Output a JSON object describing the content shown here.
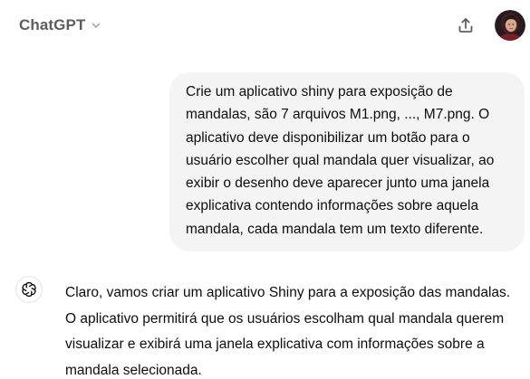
{
  "header": {
    "model_name": "ChatGPT"
  },
  "user_message": {
    "lines": [
      "Crie um aplicativo shiny para exposição de",
      "mandalas, são 7 arquivos M1.png, ..., M7.png. O",
      "aplicativo deve disponibilizar um botão para o",
      "usuário escolher qual mandala quer visualizar, ao",
      "exibir o desenho deve aparecer junto uma janela",
      "explicativa contendo informações sobre aquela",
      "mandala, cada mandala tem um texto diferente."
    ]
  },
  "assistant_message": {
    "lines": [
      "Claro, vamos criar um aplicativo Shiny para a exposição das mandalas.",
      "O aplicativo permitirá que os usuários escolham qual mandala querem",
      "visualizar e exibirá uma janela explicativa com informações sobre a",
      "mandala selecionada."
    ]
  },
  "icons": {
    "chevron": "chevron-down-icon",
    "share": "share-icon",
    "assistant": "openai-logo-icon",
    "profile": "user-avatar"
  }
}
